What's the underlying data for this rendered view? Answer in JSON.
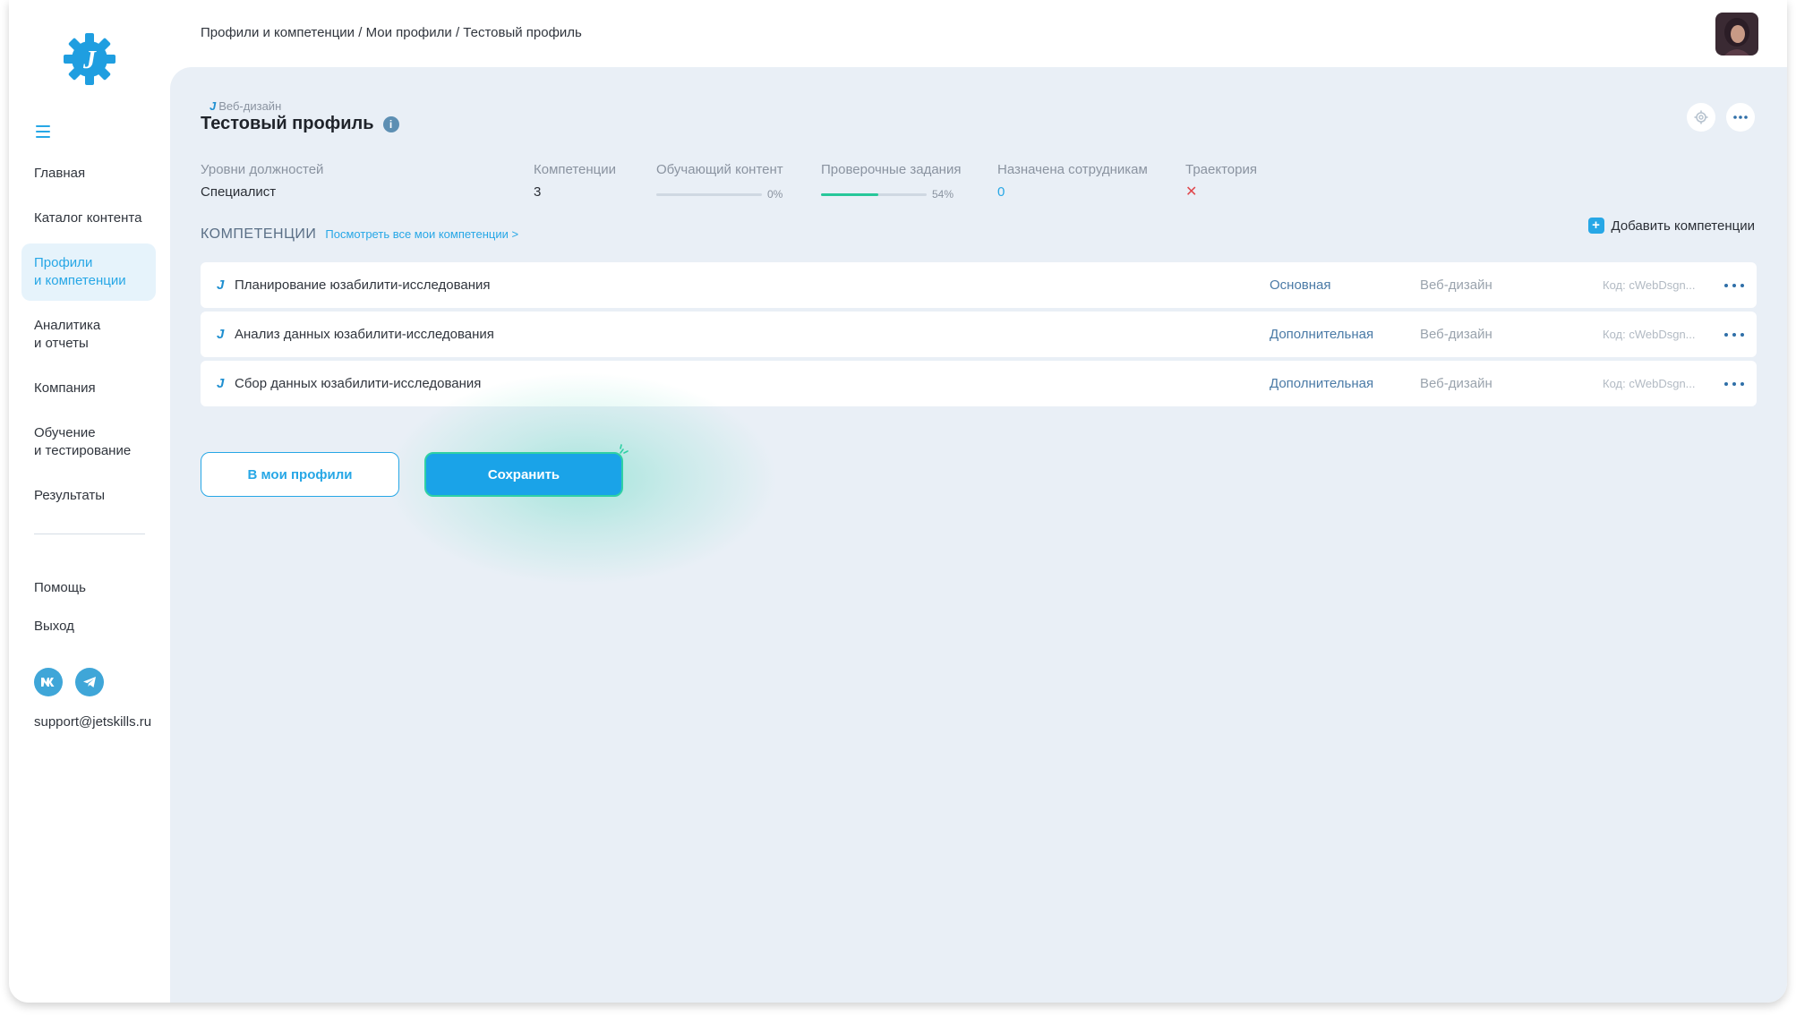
{
  "sidebar": {
    "logo_letter": "J",
    "items": [
      {
        "label": "Главная"
      },
      {
        "label": "Каталог контента"
      },
      {
        "label": "Профили\nи компетенции"
      },
      {
        "label": "Аналитика\nи отчеты"
      },
      {
        "label": "Компания"
      },
      {
        "label": "Обучение\nи тестирование"
      },
      {
        "label": "Результаты"
      }
    ],
    "active_index": 2,
    "help": "Помощь",
    "logout": "Выход",
    "socials": [
      "vk-icon",
      "telegram-icon"
    ],
    "support_email": "support@jetskills.ru"
  },
  "header": {
    "breadcrumb": "Профили и компетенции / Мои профили / Тестовый профиль"
  },
  "profile": {
    "category_letter": "J",
    "category": "Веб-дизайн",
    "title": "Тестовый профиль",
    "info_glyph": "i"
  },
  "stats": {
    "levels_label": "Уровни должностей",
    "levels_value": "Специалист",
    "competencies_label": "Компетенции",
    "competencies_value": "3",
    "content_label": "Обучающий контент",
    "content_progress": 0,
    "content_text": "0%",
    "tasks_label": "Проверочные задания",
    "tasks_progress": 54,
    "tasks_text": "54%",
    "assigned_label": "Назначена сотрудникам",
    "assigned_value": "0",
    "trajectory_label": "Траектория",
    "trajectory_value": "✕"
  },
  "section": {
    "title": "КОМПЕТЕНЦИИ",
    "link": "Посмотреть все мои компетенции >",
    "add_label": "Добавить компетенции",
    "add_glyph": "+"
  },
  "competencies": [
    {
      "letter": "J",
      "name": "Планирование юзабилити-исследования",
      "type": "Основная",
      "category": "Веб-дизайн",
      "code": "Код: cWebDsgn..."
    },
    {
      "letter": "J",
      "name": "Анализ данных юзабилити-исследования",
      "type": "Дополнительная",
      "category": "Веб-дизайн",
      "code": "Код: cWebDsgn..."
    },
    {
      "letter": "J",
      "name": "Сбор данных юзабилити-исследования",
      "type": "Дополнительная",
      "category": "Веб-дизайн",
      "code": "Код: cWebDsgn..."
    }
  ],
  "actions": {
    "to_profiles": "В мои профили",
    "save": "Сохранить"
  },
  "colors": {
    "accent": "#27a7e6",
    "progress_green": "#27c79a",
    "panel_bg": "#e9eff6",
    "danger": "#e0474c"
  }
}
